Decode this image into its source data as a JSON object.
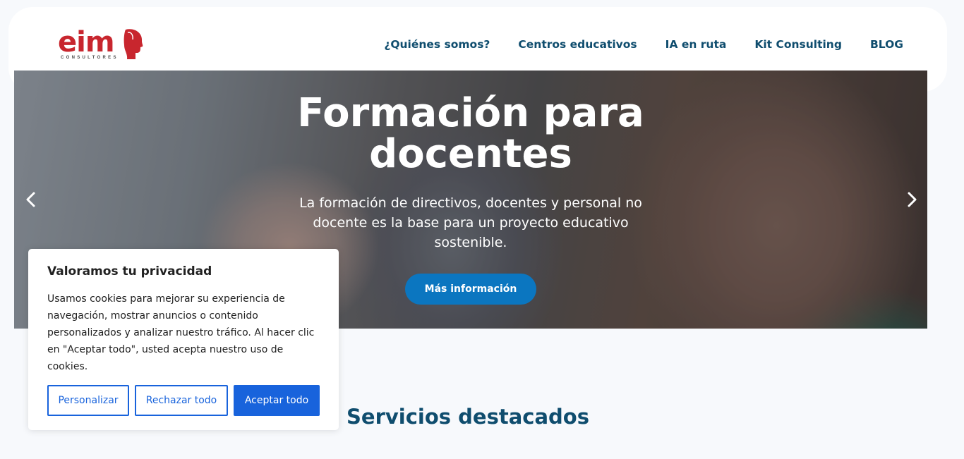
{
  "brand": {
    "logo_text": "eim",
    "logo_sub": "CONSULTORES",
    "logo_color": "#c8262e"
  },
  "nav": {
    "items": [
      {
        "label": "¿Quiénes somos?"
      },
      {
        "label": "Centros educativos"
      },
      {
        "label": "IA en ruta"
      },
      {
        "label": "Kit Consulting"
      },
      {
        "label": "BLOG"
      }
    ]
  },
  "hero": {
    "title_line1": "Formación para",
    "title_line2": "docentes",
    "subtitle": "La formación de directivos, docentes y personal no docente es la base para un proyecto educativo sostenible.",
    "button_label": "Más información",
    "prev_icon": "chevron-left",
    "next_icon": "chevron-right",
    "button_color": "#0b76c0"
  },
  "section": {
    "title_bold": "Servicios",
    "title_rest": "destacados"
  },
  "cookie": {
    "title": "Valoramos tu privacidad",
    "text": "Usamos cookies para mejorar su experiencia de navegación, mostrar anuncios o contenido personalizados y analizar nuestro tráfico. Al hacer clic en \"Aceptar todo\", usted acepta nuestro uso de cookies.",
    "customize_label": "Personalizar",
    "reject_label": "Rechazar todo",
    "accept_label": "Aceptar todo",
    "accent_color": "#1863dc"
  }
}
